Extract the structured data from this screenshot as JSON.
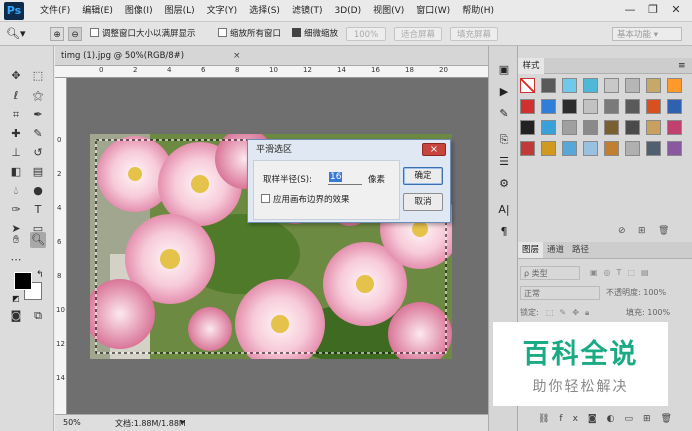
{
  "app": {
    "logo": "Ps"
  },
  "menu": [
    "文件(F)",
    "编辑(E)",
    "图像(I)",
    "图层(L)",
    "文字(Y)",
    "选择(S)",
    "滤镜(T)",
    "3D(D)",
    "视图(V)",
    "窗口(W)",
    "帮助(H)"
  ],
  "window": {
    "minimize": "—",
    "restore": "❐",
    "close": "✕"
  },
  "options": {
    "resize_windows": "调整窗口大小以满屏显示",
    "zoom_all": "缩放所有窗口",
    "scrubby_zoom": "细微缩放",
    "zoom_value": "100%",
    "fit_screen": "适合屏幕",
    "fill_screen": "填充屏幕",
    "workspace": "基本功能"
  },
  "document": {
    "tab": "timg (1).jpg @ 50%(RGB/8#)",
    "close": "×",
    "zoom": "50%",
    "doc_info": "文档:1.88M/1.88M"
  },
  "ruler_top": [
    "0",
    "2",
    "4",
    "6",
    "8",
    "10",
    "12",
    "14",
    "16",
    "18",
    "20"
  ],
  "ruler_left": [
    "0",
    "2",
    "4",
    "6",
    "8",
    "10",
    "12",
    "14"
  ],
  "dialog": {
    "title": "平滑选区",
    "radius_label": "取样半径(S):",
    "radius_value": "16",
    "unit": "像素",
    "canvas_bounds": "应用画布边界的效果",
    "ok": "确定",
    "cancel": "取消",
    "close": "×"
  },
  "styles_panel": {
    "tab": "样式",
    "swatches": [
      "#ffffff",
      "#5a5a5a",
      "#6fc9ea",
      "#4fb8d8",
      "#c8c8c8",
      "#b6b6b6",
      "#c6a868",
      "#ff9a2a",
      "#d03030",
      "#2f7fd8",
      "#2c2c2c",
      "#c2c2c2",
      "#7a7a7a",
      "#5a5a5a",
      "#d85020",
      "#2e62b0",
      "#222222",
      "#3aa0d8",
      "#a0a0a0",
      "#8a8a8a",
      "#7a6030",
      "#4a4a4a",
      "#c8a060",
      "#c04070",
      "#c03a3a",
      "#d09a20",
      "#56a8d8",
      "#9ac0e0",
      "#c08030",
      "#b0b0b0",
      "#506070",
      "#8858a0"
    ]
  },
  "layers_panel": {
    "tabs": [
      "图层",
      "通道",
      "路径"
    ],
    "kind": "ρ 类型",
    "blend_mode": "正常",
    "opacity": "不透明度: 100%",
    "lock": "锁定:",
    "fill": "填充: 100%"
  },
  "watermark": {
    "title": "百科全说",
    "subtitle": "助你轻松解决"
  }
}
